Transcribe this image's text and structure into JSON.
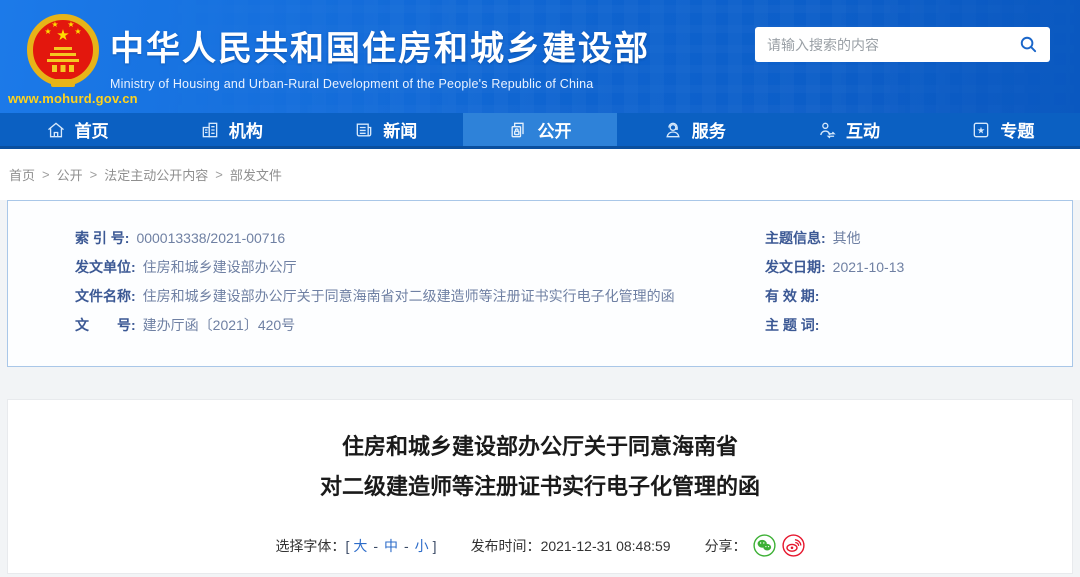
{
  "header": {
    "site_url": "www.mohurd.gov.cn",
    "title": "中华人民共和国住房和城乡建设部",
    "subtitle": "Ministry of Housing and Urban-Rural Development of the People's Republic of China",
    "search_placeholder": "请输入搜索的内容"
  },
  "nav": {
    "items": [
      {
        "label": "首页",
        "icon": "home-icon",
        "active": false
      },
      {
        "label": "机构",
        "icon": "organization-icon",
        "active": false
      },
      {
        "label": "新闻",
        "icon": "news-icon",
        "active": false
      },
      {
        "label": "公开",
        "icon": "disclosure-icon",
        "active": true
      },
      {
        "label": "服务",
        "icon": "service-icon",
        "active": false
      },
      {
        "label": "互动",
        "icon": "interaction-icon",
        "active": false
      },
      {
        "label": "专题",
        "icon": "topics-icon",
        "active": false
      }
    ]
  },
  "breadcrumb": {
    "separator": ">",
    "items": [
      "首页",
      "公开",
      "法定主动公开内容",
      "部发文件"
    ]
  },
  "info": {
    "left": [
      {
        "label": "索 引 号:",
        "value": "000013338/2021-00716"
      },
      {
        "label": "发文单位:",
        "value": "住房和城乡建设部办公厅"
      },
      {
        "label": "文件名称:",
        "value": "住房和城乡建设部办公厅关于同意海南省对二级建造师等注册证书实行电子化管理的函"
      },
      {
        "label": "文　　号:",
        "value": "建办厅函〔2021〕420号"
      }
    ],
    "right": [
      {
        "label": "主题信息:",
        "value": "其他"
      },
      {
        "label": "发文日期:",
        "value": "2021-10-13"
      },
      {
        "label": "有 效 期:",
        "value": ""
      },
      {
        "label": "主 题 词:",
        "value": ""
      }
    ]
  },
  "article": {
    "title_line1": "住房和城乡建设部办公厅关于同意海南省",
    "title_line2": "对二级建造师等注册证书实行电子化管理的函",
    "font_label": "选择字体：",
    "bracket_open": "[",
    "size_large": "大",
    "dash1": "-",
    "size_medium": "中",
    "dash2": "-",
    "size_small": "小",
    "bracket_close": "]",
    "publish_label": "发布时间：",
    "publish_time": "2021-12-31 08:48:59",
    "share_label": "分享："
  },
  "colors": {
    "accent_blue": "#0b60c2",
    "active_tab": "#2e82d9",
    "gold": "#ffd31c",
    "wechat_green": "#3db035",
    "weibo_red": "#e6162d"
  }
}
